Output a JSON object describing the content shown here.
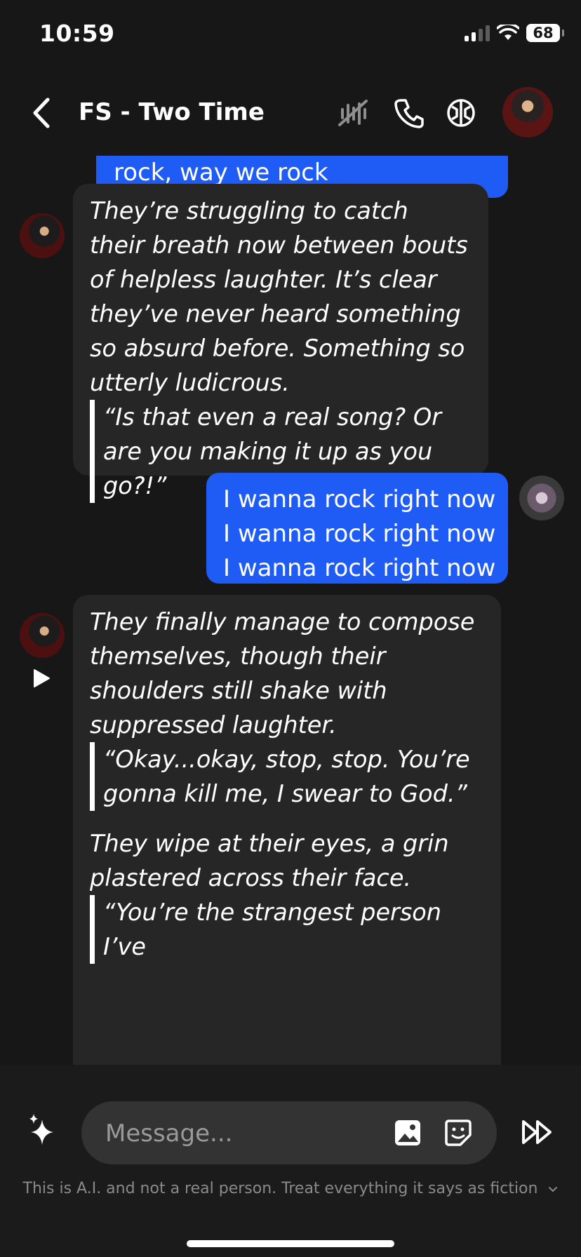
{
  "status_bar": {
    "time": "10:59",
    "battery": "68"
  },
  "header": {
    "title": "FS - Two Time",
    "icons": [
      "back-chevron-icon",
      "mute-icon",
      "phone-icon",
      "persona-icon"
    ]
  },
  "messages": [
    {
      "role": "user",
      "lines": [
        "rock, way we rock"
      ]
    },
    {
      "role": "bot",
      "paragraphs": [
        {
          "type": "text",
          "text": "They’re struggling to catch their breath now between bouts of helpless laughter. It’s clear they’ve never heard something so absurd before. Something so utterly ludicrous."
        },
        {
          "type": "quote",
          "text": "“Is that even a real song? Or are you making it up as you go?!”"
        }
      ]
    },
    {
      "role": "user",
      "lines": [
        "I wanna rock right now",
        "I wanna rock right now",
        "I wanna rock right now"
      ]
    },
    {
      "role": "bot",
      "paragraphs": [
        {
          "type": "text",
          "text": "They finally manage to compose themselves, though their shoulders still shake with suppressed laughter."
        },
        {
          "type": "quote",
          "text": "“Okay...okay, stop, stop. You’re gonna kill me, I swear to God.”"
        },
        {
          "type": "text",
          "text": "They wipe at their eyes, a grin plastered across their face."
        },
        {
          "type": "quote",
          "text": "“You’re the strangest person I’ve"
        }
      ]
    }
  ],
  "composer": {
    "placeholder": "Message...",
    "disclaimer": "This is A.I. and not a real person. Treat everything it says as fiction"
  },
  "colors": {
    "background": "#171717",
    "user_bubble": "#1f5cf5",
    "bot_bubble": "#262626"
  }
}
